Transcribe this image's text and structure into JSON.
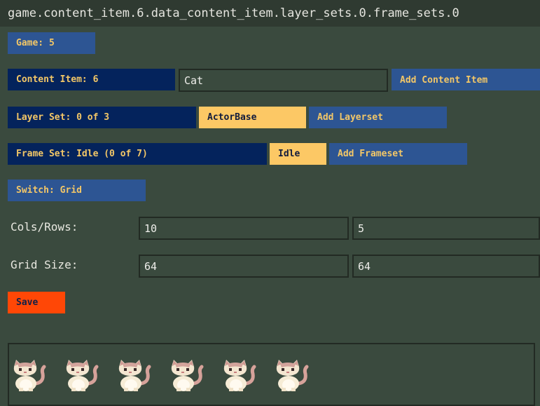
{
  "title": "game.content_item.6.data_content_item.layer_sets.0.frame_sets.0",
  "game_button": "Game: 5",
  "content_item": {
    "label": "Content Item: 6",
    "name_value": "Cat",
    "add_label": "Add Content Item"
  },
  "layer_set": {
    "label": "Layer Set: 0 of 3",
    "current": "ActorBase",
    "add_label": "Add Layerset"
  },
  "frame_set": {
    "label": "Frame Set: Idle (0 of 7)",
    "current": "Idle",
    "add_label": "Add Frameset"
  },
  "switch_button": "Switch: Grid",
  "cols_rows": {
    "label": "Cols/Rows:",
    "cols": "10",
    "rows": "5"
  },
  "grid_size": {
    "label": "Grid Size:",
    "width": "64",
    "height": "64"
  },
  "save_label": "Save",
  "preview": {
    "sprite_count": 6,
    "sprite_icon": "cat-sprite-icon"
  },
  "colors": {
    "background": "#3a4a3e",
    "blue_button": "#2d5593",
    "navy_button": "#04235c",
    "gold_button": "#fcc865",
    "save_button": "#ff4706",
    "button_text": "#f3c767"
  }
}
